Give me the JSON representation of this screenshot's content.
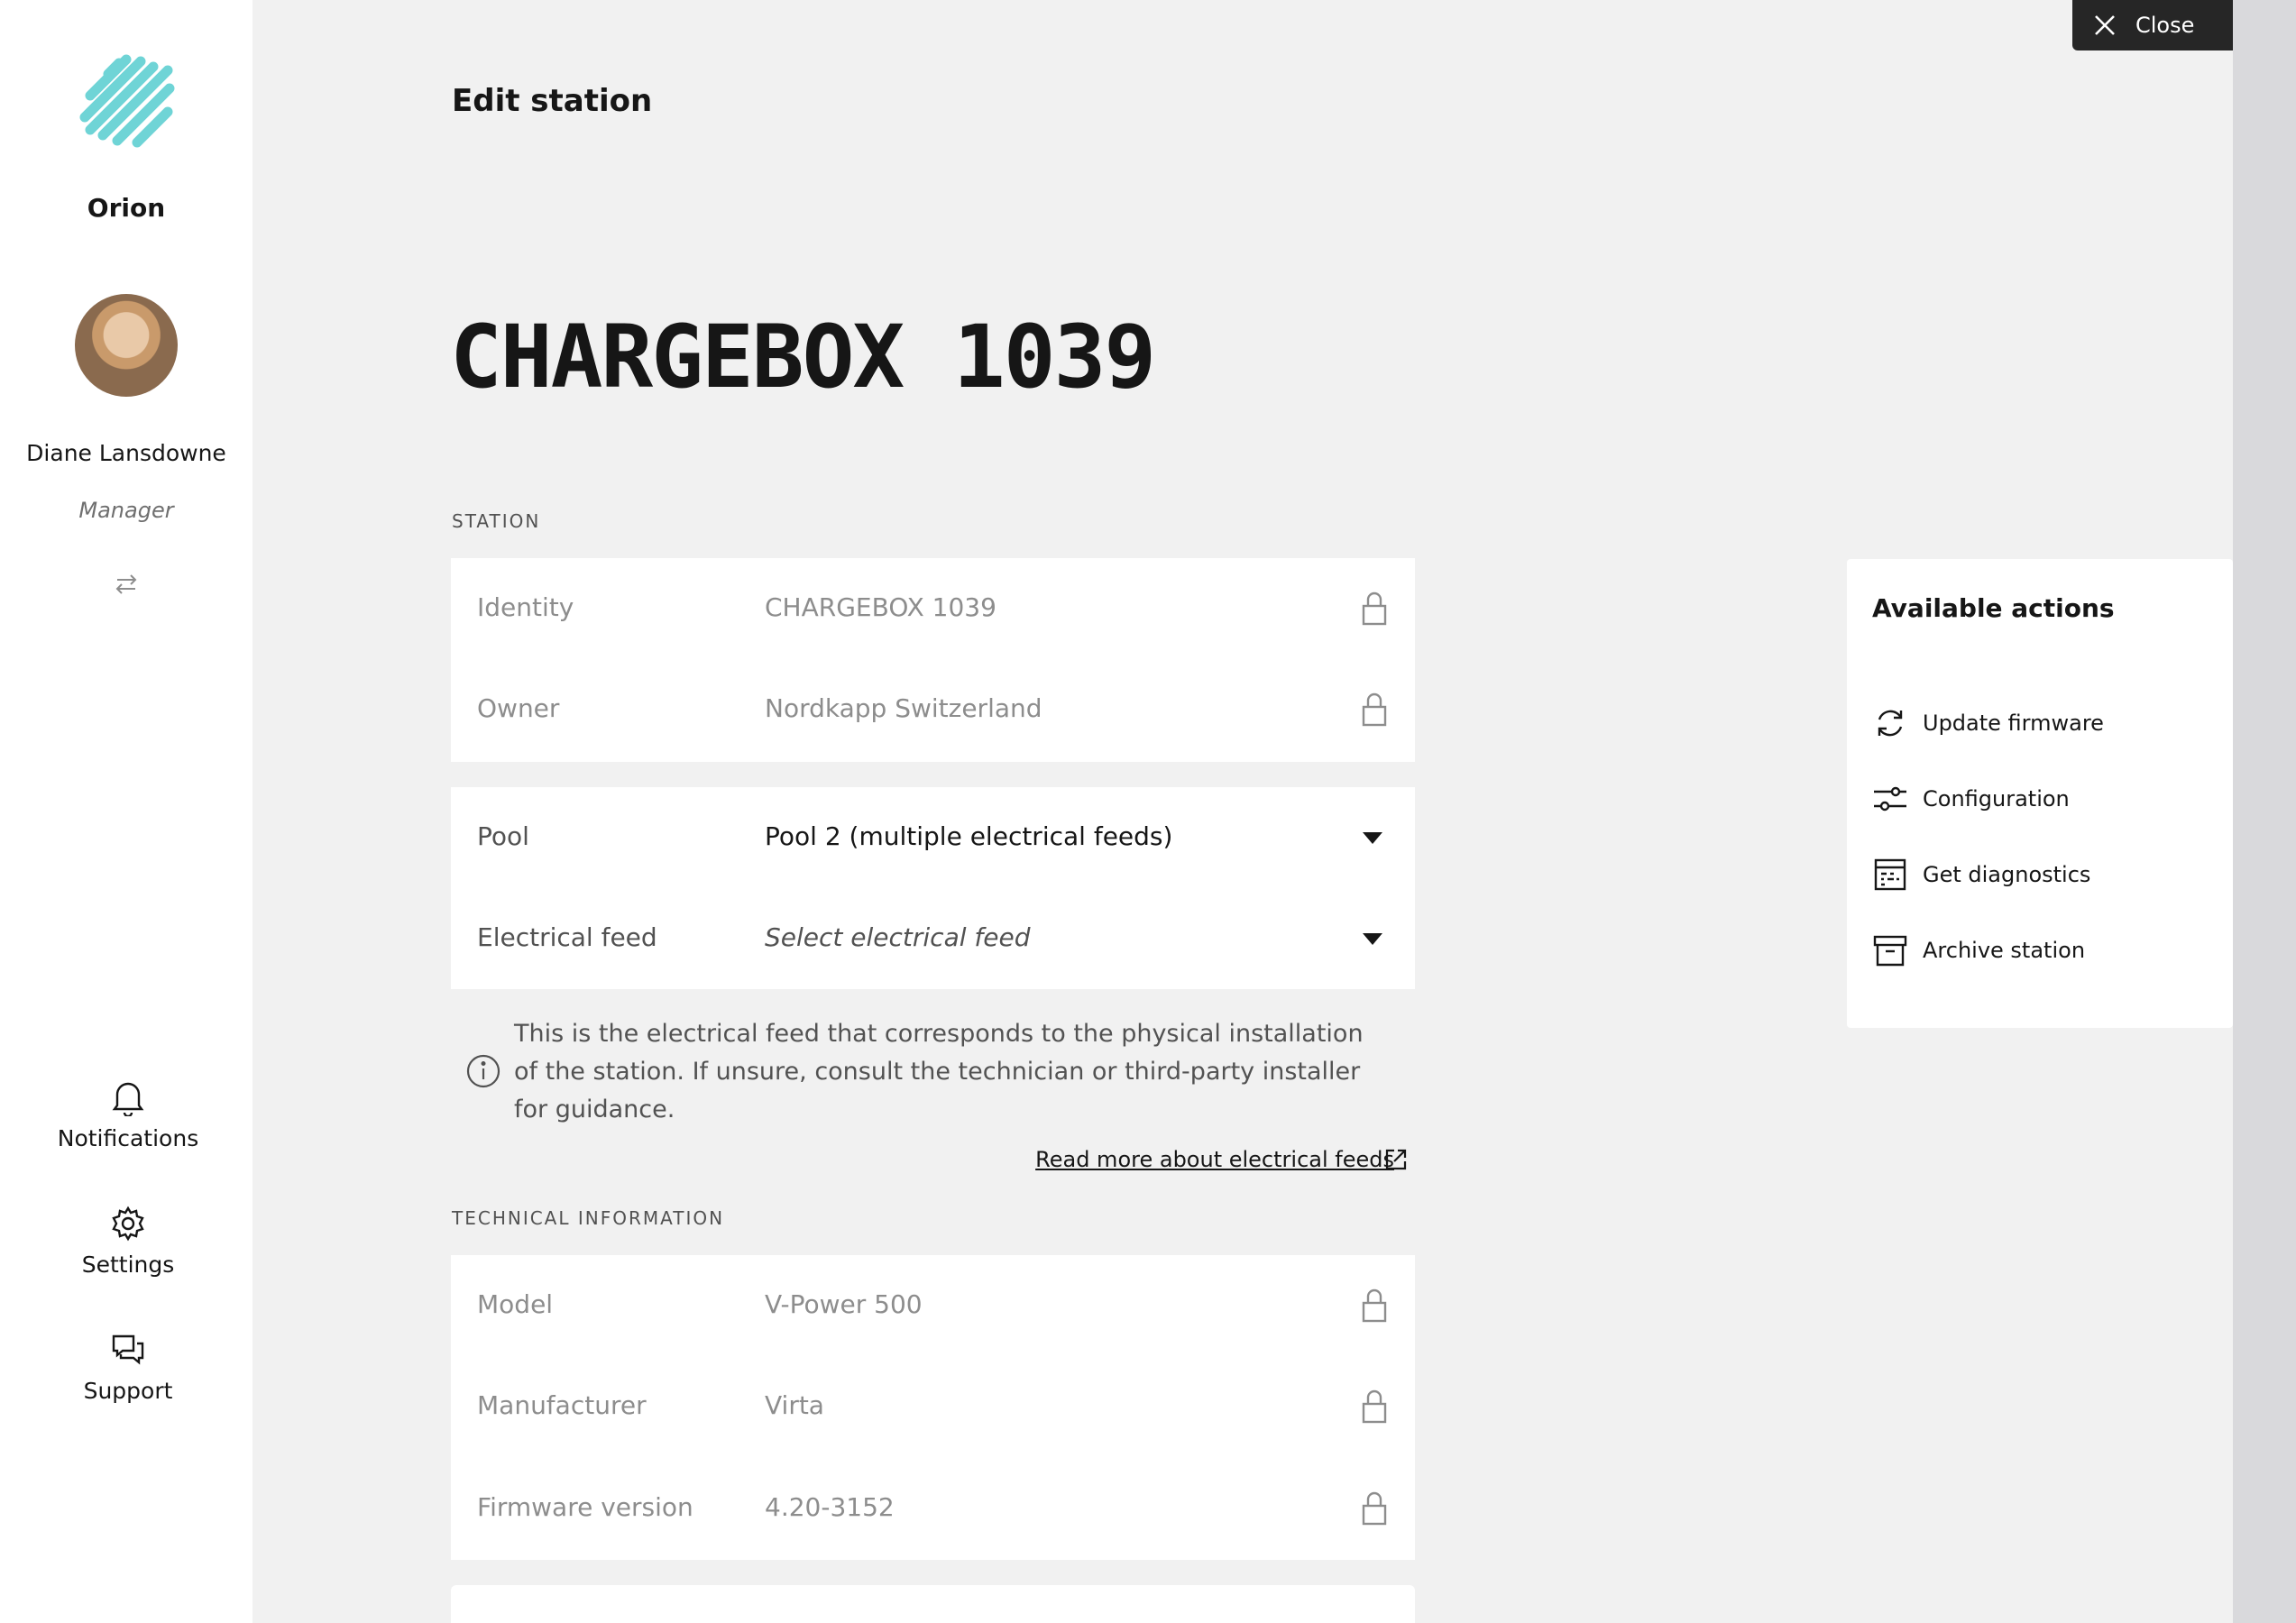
{
  "sidebar": {
    "brand": "Orion",
    "user": {
      "name": "Diane Lansdowne",
      "role": "Manager"
    },
    "nav": [
      {
        "label": "Notifications",
        "icon": "bell-icon"
      },
      {
        "label": "Settings",
        "icon": "gear-icon"
      },
      {
        "label": "Support",
        "icon": "chat-icon"
      }
    ]
  },
  "header": {
    "close_label": "Close"
  },
  "main": {
    "page_title": "Edit station",
    "station_name": "CHARGEBOX 1039",
    "station_section": {
      "label": "STATION",
      "locked_fields": [
        {
          "label": "Identity",
          "value": "CHARGEBOX 1039"
        },
        {
          "label": "Owner",
          "value": "Nordkapp Switzerland"
        }
      ],
      "pool": {
        "label": "Pool",
        "value": "Pool 2 (multiple electrical feeds)"
      },
      "electrical_feed": {
        "label": "Electrical feed",
        "placeholder": "Select electrical feed"
      },
      "info_text": "This is the electrical feed that corresponds to the physical installation of the station. If unsure, consult the technician or third-party installer for guidance.",
      "read_more": "Read more about electrical feeds"
    },
    "technical_section": {
      "label": "TECHNICAL INFORMATION",
      "fields": [
        {
          "label": "Model",
          "value": "V-Power 500"
        },
        {
          "label": "Manufacturer",
          "value": "Virta"
        },
        {
          "label": "Firmware version",
          "value": "4.20-3152"
        }
      ]
    }
  },
  "actions": {
    "title": "Available actions",
    "items": [
      {
        "label": "Update firmware",
        "icon": "refresh-icon"
      },
      {
        "label": "Configuration",
        "icon": "sliders-icon"
      },
      {
        "label": "Get diagnostics",
        "icon": "diagnostics-icon"
      },
      {
        "label": "Archive station",
        "icon": "archive-icon"
      }
    ]
  },
  "colors": {
    "brand_accent": "#6fd4d6",
    "sidebar_bg": "#ffffff",
    "page_bg": "#f1f1f1",
    "close_bg": "#262626"
  }
}
